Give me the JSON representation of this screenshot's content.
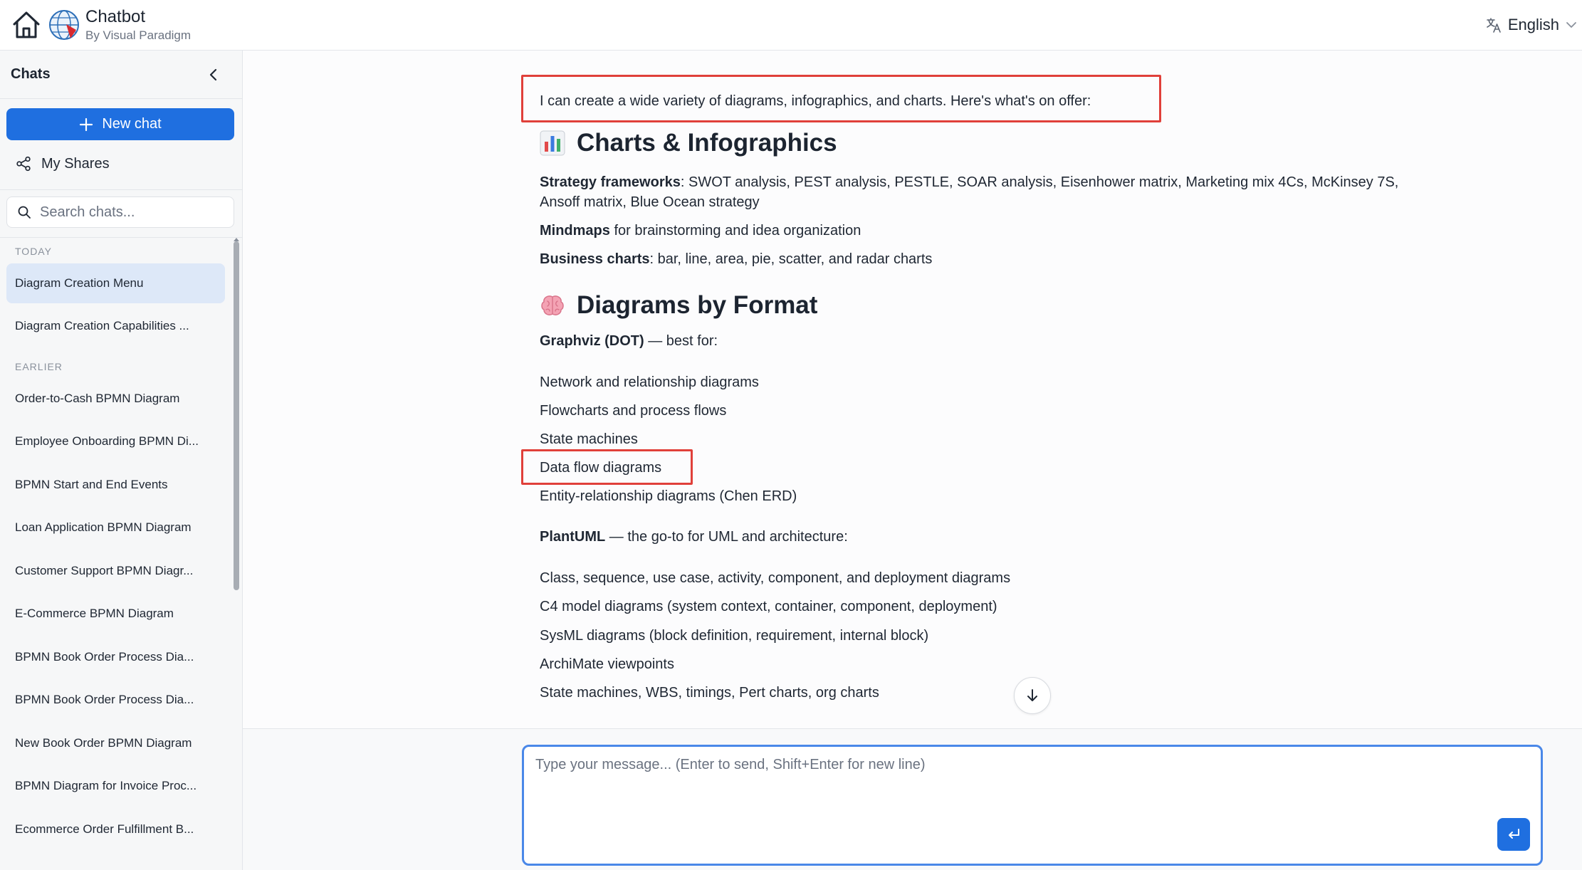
{
  "header": {
    "title": "Chatbot",
    "subtitle": "By Visual Paradigm",
    "language": "English"
  },
  "sidebar": {
    "title": "Chats",
    "new_chat_label": "New chat",
    "my_shares_label": "My Shares",
    "search_placeholder": "Search chats...",
    "groups": [
      {
        "label": "TODAY",
        "items": [
          "Diagram Creation Menu",
          "Diagram Creation Capabilities ..."
        ]
      },
      {
        "label": "EARLIER",
        "items": [
          "Order-to-Cash BPMN Diagram",
          "Employee Onboarding BPMN Di...",
          "BPMN Start and End Events",
          "Loan Application BPMN Diagram",
          "Customer Support BPMN Diagr...",
          "E-Commerce BPMN Diagram",
          "BPMN Book Order Process Dia...",
          "BPMN Book Order Process Dia...",
          "New Book Order BPMN Diagram",
          "BPMN Diagram for Invoice Proc...",
          "Ecommerce Order Fulfillment B..."
        ]
      }
    ],
    "active_item": "Diagram Creation Menu"
  },
  "message": {
    "intro": "I can create a wide variety of diagrams, infographics, and charts. Here's what's on offer:",
    "section1": {
      "heading": "Charts & Infographics",
      "emoji": "bar-chart-icon",
      "items": [
        {
          "bold": "Strategy frameworks",
          "text": ": SWOT analysis, PEST analysis, PESTLE, SOAR analysis, Eisenhower matrix, Marketing mix 4Cs, McKinsey 7S,",
          "cont": "Ansoff matrix, Blue Ocean strategy"
        },
        {
          "bold": "Mindmaps",
          "text": " for brainstorming and idea organization"
        },
        {
          "bold": "Business charts",
          "text": ": bar, line, area, pie, scatter, and radar charts"
        }
      ]
    },
    "section2": {
      "heading": "Diagrams by Format",
      "emoji": "brain-icon",
      "graphviz": {
        "bold": "Graphviz (DOT)",
        "text": " — best for:",
        "items": [
          "Network and relationship diagrams",
          "Flowcharts and process flows",
          "State machines",
          "Data flow diagrams",
          "Entity-relationship diagrams (Chen ERD)"
        ]
      },
      "plantuml": {
        "bold": "PlantUML",
        "text": " — the go-to for UML and architecture:",
        "items": [
          "Class, sequence, use case, activity, component, and deployment diagrams",
          "C4 model diagrams (system context, container, component, deployment)",
          "SysML diagrams (block definition, requirement, internal block)",
          "ArchiMate viewpoints",
          "State machines, WBS, timings, Pert charts, org charts"
        ]
      }
    }
  },
  "composer": {
    "placeholder": "Type your message... (Enter to send, Shift+Enter for new line)"
  },
  "colors": {
    "accent": "#1f6fe0",
    "highlight": "#e0403a",
    "active_item_bg": "#dde8f8"
  }
}
